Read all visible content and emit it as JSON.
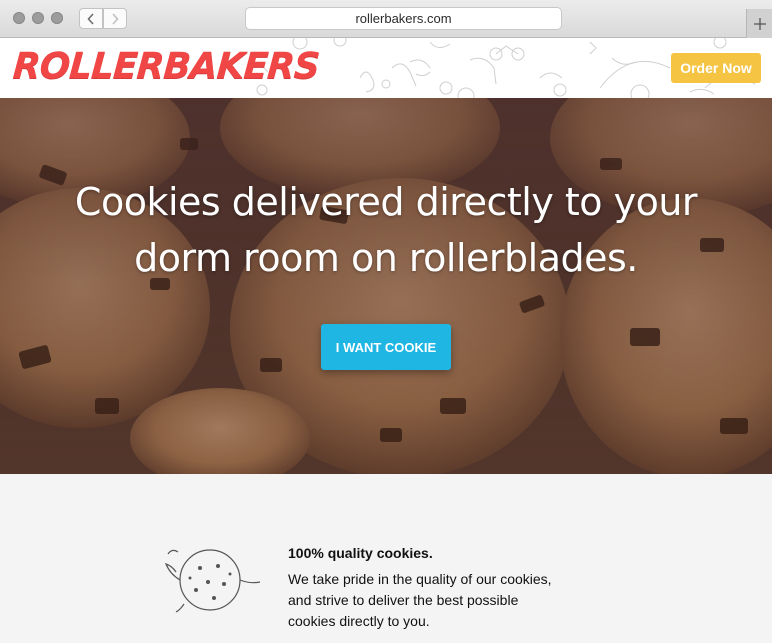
{
  "browser": {
    "url": "rollerbakers.com",
    "back_icon": "chevron-left-icon",
    "forward_icon": "chevron-right-icon",
    "new_tab_icon": "plus-icon"
  },
  "header": {
    "logo_text": "ROLLERBAKERS",
    "order_button": "Order Now"
  },
  "hero": {
    "title_line1": "Cookies delivered directly to your",
    "title_line2": "dorm room on rollerblades.",
    "cta_label": "I WANT COOKIE"
  },
  "features": {
    "title": "100% quality cookies.",
    "body_line1": "We take pride in the quality of our cookies,",
    "body_line2": "and strive to deliver the best possible",
    "body_line3": "cookies directly to you."
  },
  "colors": {
    "brand_red": "#f04646",
    "order_yellow": "#f6c443",
    "cta_blue": "#1fb6e4",
    "section_bg": "#f4f4f4"
  }
}
